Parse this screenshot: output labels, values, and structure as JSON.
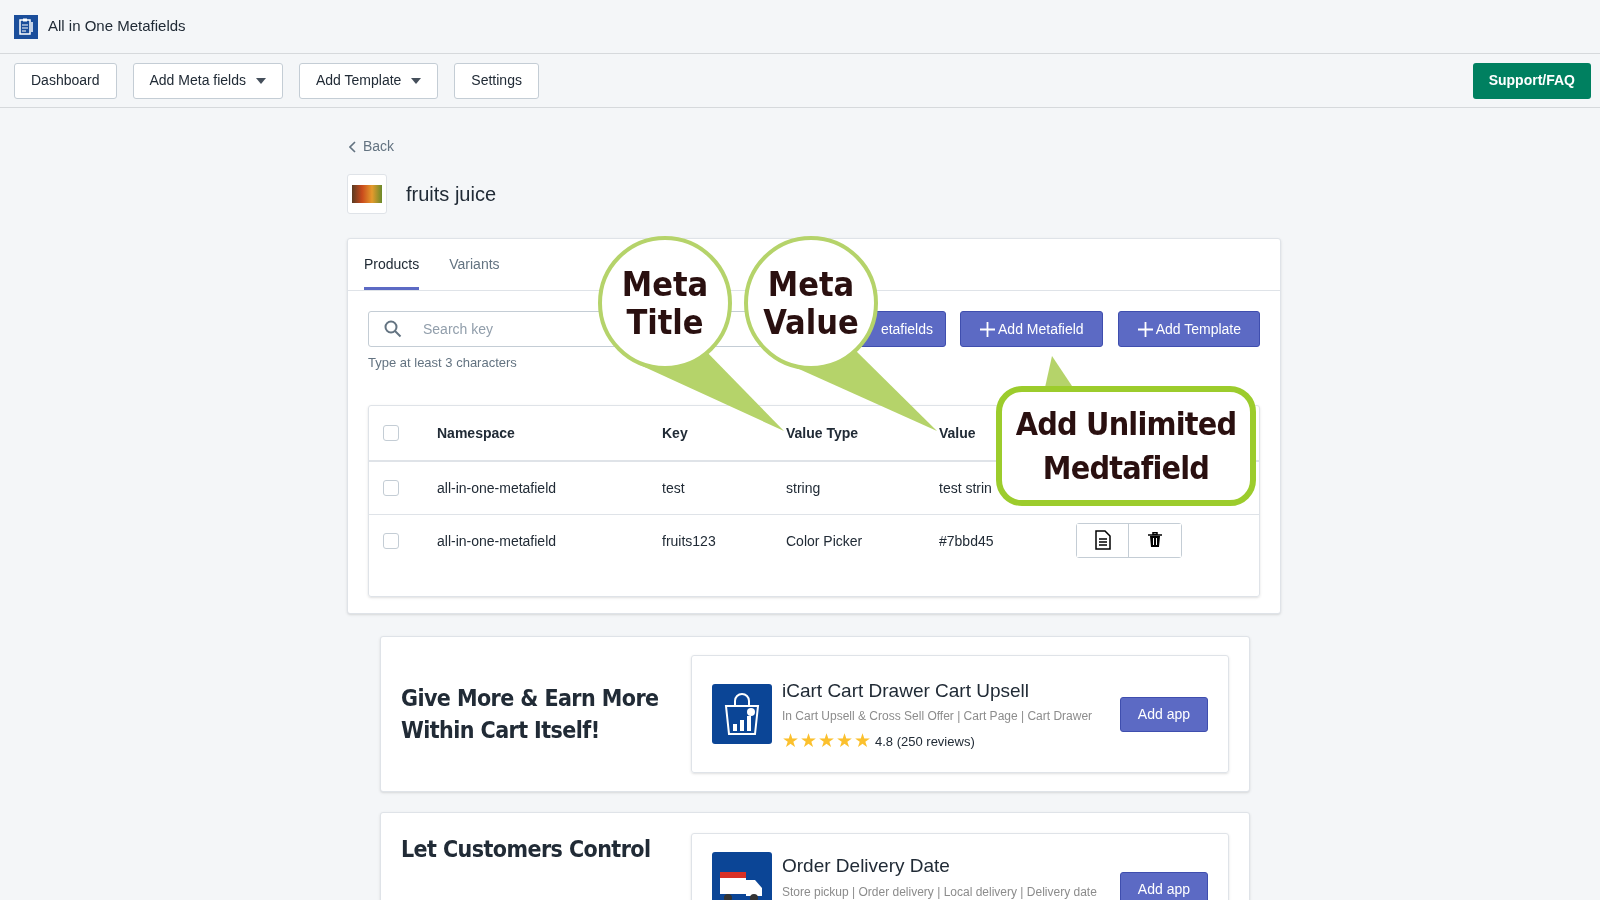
{
  "app": {
    "title": "All in One Metafields"
  },
  "toolbar": [
    {
      "label": "Dashboard",
      "kind": "button"
    },
    {
      "label": "Add Meta fields",
      "kind": "dropdown"
    },
    {
      "label": "Add Template",
      "kind": "dropdown"
    },
    {
      "label": "Settings",
      "kind": "button"
    }
  ],
  "support_button": "Support/FAQ",
  "back_link": "Back",
  "product": {
    "title": "fruits juice"
  },
  "tabs": [
    {
      "label": "Products",
      "selected": true
    },
    {
      "label": "Variants",
      "selected": false
    }
  ],
  "search": {
    "placeholder": "Search key",
    "hint": "Type at least 3 characters"
  },
  "action_buttons": [
    {
      "label": "etafields",
      "kind": "plain"
    },
    {
      "label": "Add Metafield",
      "kind": "plus"
    },
    {
      "label": "Add Template",
      "kind": "plus"
    }
  ],
  "table": {
    "select_all": {
      "checked": false
    },
    "columns": [
      "Namespace",
      "Key",
      "Value Type",
      "Value"
    ],
    "rows": [
      {
        "checked": false,
        "cells": [
          "all-in-one-metafield",
          "test",
          "string",
          "test strin"
        ]
      },
      {
        "checked": false,
        "cells": [
          "all-in-one-metafield",
          "fruits123",
          "Color Picker",
          "#7bbd45"
        ]
      }
    ]
  },
  "promos": [
    {
      "heading": "Give More & Earn More Within Cart Itself!",
      "app": {
        "name": "iCart Cart Drawer Cart Upsell",
        "subtitle": "In Cart Upsell & Cross Sell Offer | Cart Page | Cart Drawer",
        "stars": 5,
        "rating": "4.8 (250 reviews)",
        "button": "Add app"
      }
    },
    {
      "heading": "Let Customers Control",
      "app": {
        "name": "Order Delivery Date",
        "subtitle": "Store pickup | Order delivery | Local delivery | Delivery date",
        "button": "Add app"
      }
    }
  ],
  "callouts": [
    {
      "kind": "circle",
      "lines": [
        "Meta",
        "Title"
      ]
    },
    {
      "kind": "circle",
      "lines": [
        "Meta",
        "Value"
      ]
    },
    {
      "kind": "box",
      "lines": [
        "Add Unlimited",
        "Medtafield"
      ]
    }
  ]
}
